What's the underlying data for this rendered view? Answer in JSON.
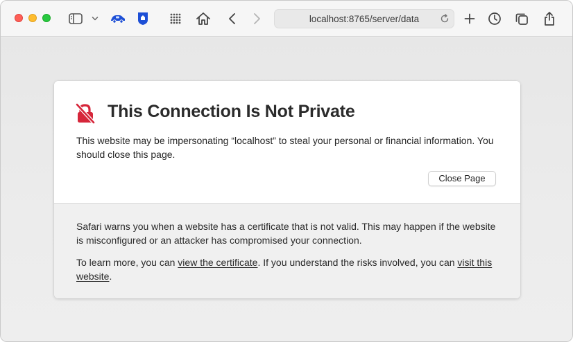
{
  "browser": {
    "url": "localhost:8765/server/data",
    "toolbar_icons": [
      "sidebar-icon",
      "chevron-down-icon",
      "car-extension-icon",
      "shield-extension-icon",
      "grid-icon",
      "home-icon",
      "back-icon",
      "forward-icon",
      "reload-icon",
      "new-tab-icon",
      "history-clock-icon",
      "tabs-overview-icon",
      "share-icon"
    ]
  },
  "error_page": {
    "title": "This Connection Is Not Private",
    "warning_text": "This website may be impersonating “localhost” to steal your personal or financial information. You should close this page.",
    "close_button": "Close Page",
    "explanation": "Safari warns you when a website has a certificate that is not valid. This may happen if the website is misconfigured or an attacker has compromised your connection.",
    "learn_prefix": "To learn more, you can ",
    "view_certificate_link": "view the certificate",
    "learn_middle": ". If you understand the risks involved, you can ",
    "visit_link": "visit this website",
    "learn_suffix": "."
  },
  "colors": {
    "lock_icon": "#d6263a",
    "close_red": "#fe5f57",
    "minimize_yellow": "#febc2e",
    "zoom_green": "#28c840",
    "extension_blue": "#1d4fd6"
  }
}
